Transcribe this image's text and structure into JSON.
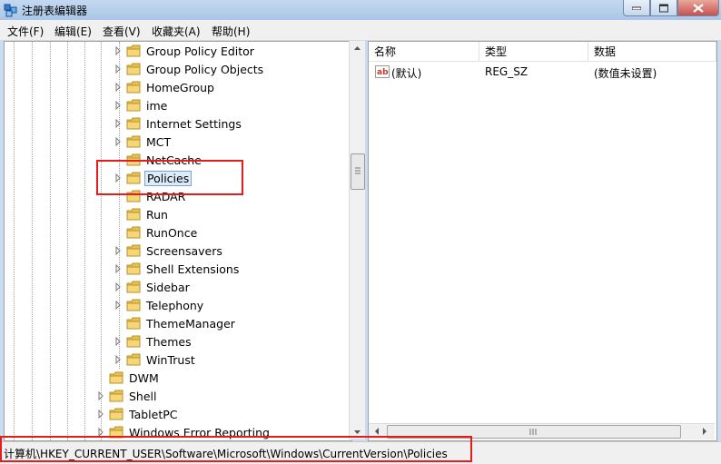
{
  "window": {
    "title": "注册表编辑器"
  },
  "menu": [
    "文件(F)",
    "编辑(E)",
    "查看(V)",
    "收藏夹(A)",
    "帮助(H)"
  ],
  "tree": {
    "children": [
      {
        "label": "Group Policy Editor",
        "expandable": true
      },
      {
        "label": "Group Policy Objects",
        "expandable": true
      },
      {
        "label": "HomeGroup",
        "expandable": true
      },
      {
        "label": "ime",
        "expandable": true
      },
      {
        "label": "Internet Settings",
        "expandable": true
      },
      {
        "label": "MCT",
        "expandable": true
      },
      {
        "label": "NetCache",
        "expandable": false
      },
      {
        "label": "Policies",
        "expandable": true,
        "selected": true
      },
      {
        "label": "RADAR",
        "expandable": false
      },
      {
        "label": "Run",
        "expandable": false
      },
      {
        "label": "RunOnce",
        "expandable": false
      },
      {
        "label": "Screensavers",
        "expandable": true
      },
      {
        "label": "Shell Extensions",
        "expandable": true
      },
      {
        "label": "Sidebar",
        "expandable": true
      },
      {
        "label": "Telephony",
        "expandable": true
      },
      {
        "label": "ThemeManager",
        "expandable": false
      },
      {
        "label": "Themes",
        "expandable": true
      },
      {
        "label": "WinTrust",
        "expandable": true
      }
    ],
    "siblings": [
      {
        "label": "DWM",
        "expandable": false
      },
      {
        "label": "Shell",
        "expandable": true
      },
      {
        "label": "TabletPC",
        "expandable": true
      },
      {
        "label": "Windows Error Reporting",
        "expandable": true
      }
    ]
  },
  "values": {
    "columns": [
      "名称",
      "类型",
      "数据"
    ],
    "rows": [
      {
        "name": "(默认)",
        "type": "REG_SZ",
        "data": "(数值未设置)"
      }
    ]
  },
  "status": {
    "path": "计算机\\HKEY_CURRENT_USER\\Software\\Microsoft\\Windows\\CurrentVersion\\Policies"
  },
  "colors": {
    "highlight": "#e41c1c",
    "folder": "#e8c14f",
    "selection": "#dcebfc"
  }
}
